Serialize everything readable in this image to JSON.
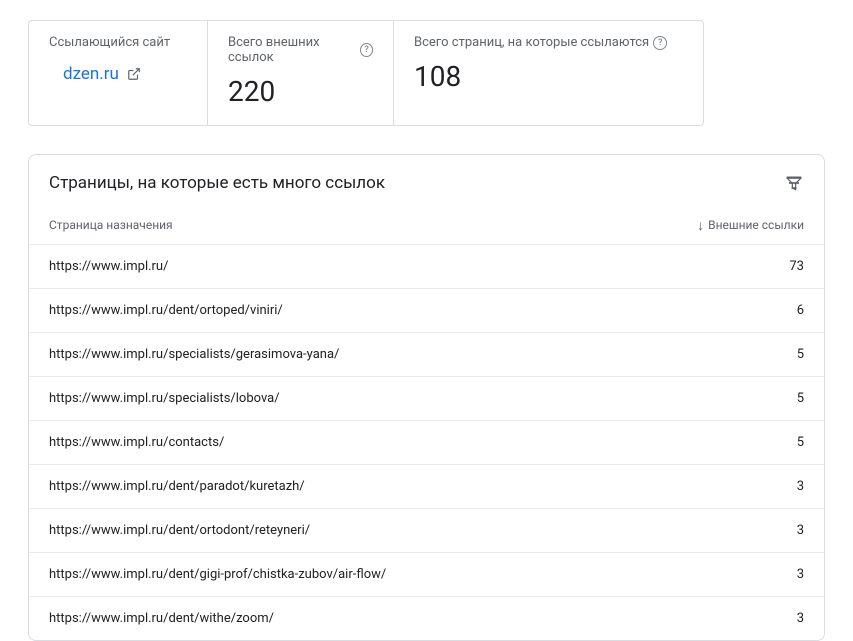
{
  "stats": {
    "site_label": "Ссылающийся сайт",
    "site_value": "dzen.ru",
    "external_links_label": "Всего внешних ссылок",
    "external_links_value": "220",
    "total_pages_label": "Всего страниц, на которые ссылаются",
    "total_pages_value": "108"
  },
  "table": {
    "title": "Страницы, на которые есть много ссылок",
    "col_page": "Страница назначения",
    "col_links": "Внешние ссылки",
    "rows": [
      {
        "url": "https://www.impl.ru/",
        "count": "73"
      },
      {
        "url": "https://www.impl.ru/dent/ortoped/viniri/",
        "count": "6"
      },
      {
        "url": "https://www.impl.ru/specialists/gerasimova-yana/",
        "count": "5"
      },
      {
        "url": "https://www.impl.ru/specialists/lobova/",
        "count": "5"
      },
      {
        "url": "https://www.impl.ru/contacts/",
        "count": "5"
      },
      {
        "url": "https://www.impl.ru/dent/paradot/kuretazh/",
        "count": "3"
      },
      {
        "url": "https://www.impl.ru/dent/ortodont/reteyneri/",
        "count": "3"
      },
      {
        "url": "https://www.impl.ru/dent/gigi-prof/chistka-zubov/air-flow/",
        "count": "3"
      },
      {
        "url": "https://www.impl.ru/dent/withe/zoom/",
        "count": "3"
      }
    ]
  }
}
